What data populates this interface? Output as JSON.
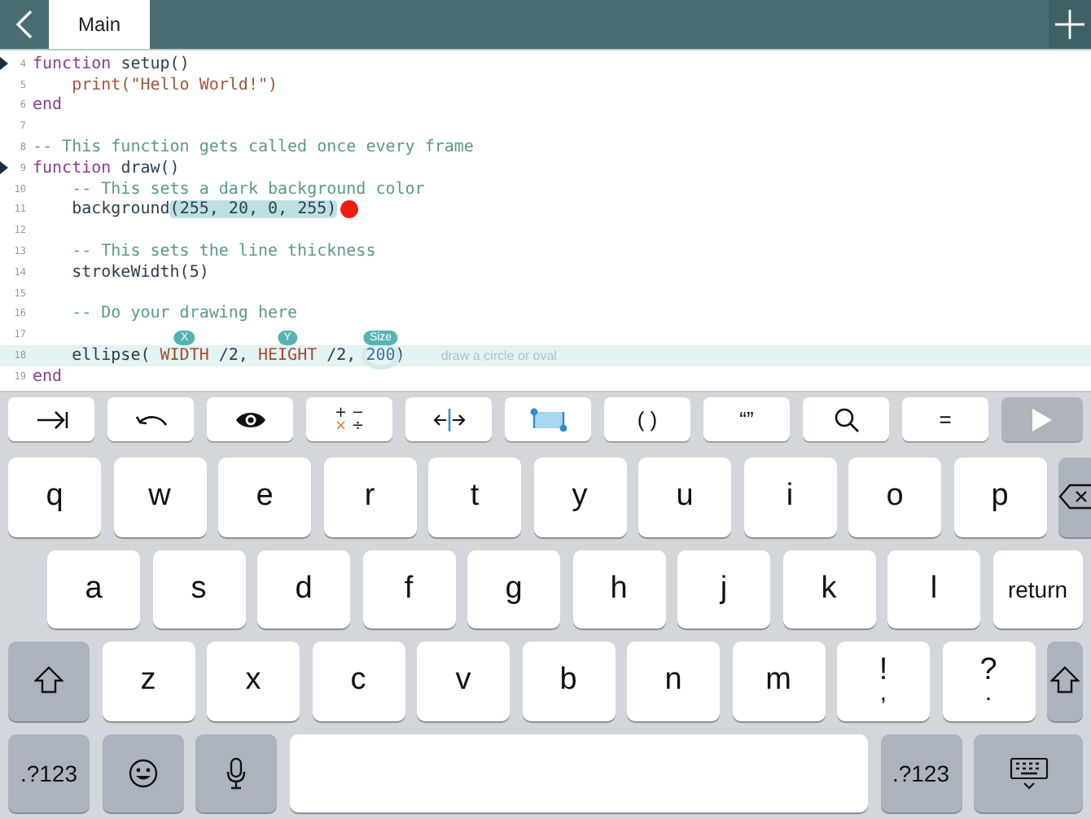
{
  "top_bar": {
    "tabs": [
      {
        "label": "Main",
        "selected": true
      }
    ]
  },
  "editor": {
    "lines": [
      {
        "number": "4",
        "fold": true,
        "current": false,
        "tokens": [
          {
            "kind": "keyword",
            "text": "function"
          },
          {
            "kind": "plain",
            "text": " setup()"
          }
        ]
      },
      {
        "number": "5",
        "fold": false,
        "current": false,
        "indented": true,
        "tokens": [
          {
            "kind": "string",
            "text": "print(\"Hello World!\")"
          }
        ]
      },
      {
        "number": "6",
        "fold": false,
        "current": false,
        "tokens": [
          {
            "kind": "keyword",
            "text": "end"
          }
        ]
      },
      {
        "number": "7",
        "fold": false,
        "current": false
      },
      {
        "number": "8",
        "fold": false,
        "current": false,
        "tokens": [
          {
            "kind": "comment",
            "text": "-- This function gets called once every frame"
          }
        ]
      },
      {
        "number": "9",
        "fold": true,
        "current": false,
        "tokens": [
          {
            "kind": "keyword",
            "text": "function"
          },
          {
            "kind": "plain",
            "text": " draw()"
          }
        ]
      },
      {
        "number": "10",
        "fold": false,
        "current": false,
        "indented": true,
        "tokens": [
          {
            "kind": "comment",
            "text": "-- This sets a dark background color"
          }
        ]
      },
      {
        "number": "11",
        "fold": false,
        "current": false,
        "indented": true,
        "color_preview": true,
        "tokens": [
          {
            "kind": "plain",
            "text": "background"
          },
          {
            "kind": "selected",
            "text": "(255, 20, 0, 255)"
          }
        ]
      },
      {
        "number": "12",
        "fold": false,
        "current": false
      },
      {
        "number": "13",
        "fold": false,
        "current": false,
        "indented": true,
        "tokens": [
          {
            "kind": "comment",
            "text": "-- This sets the line thickness"
          }
        ]
      },
      {
        "number": "14",
        "fold": false,
        "current": false,
        "indented": true,
        "tokens": [
          {
            "kind": "plain",
            "text": "strokeWidth(5)"
          }
        ]
      },
      {
        "number": "15",
        "fold": false,
        "current": false
      },
      {
        "number": "16",
        "fold": false,
        "current": false,
        "indented": true,
        "tokens": [
          {
            "kind": "comment",
            "text": "-- Do your drawing here"
          }
        ]
      },
      {
        "number": "17",
        "fold": false,
        "current": false
      },
      {
        "number": "18",
        "fold": false,
        "current": true,
        "indented": true,
        "hint": "draw a circle or oval",
        "tokens": [
          {
            "kind": "plain",
            "text": "ellipse( "
          },
          {
            "kind": "constant",
            "text": "WIDTH",
            "tag": "X"
          },
          {
            "kind": "plain",
            "text": " /2, "
          },
          {
            "kind": "constant",
            "text": "HEIGHT",
            "tag": "Y"
          },
          {
            "kind": "plain",
            "text": " /2, "
          },
          {
            "kind": "number",
            "text": "200",
            "tag": "Size"
          },
          {
            "kind": "plain",
            "text": ")"
          }
        ]
      },
      {
        "number": "19",
        "fold": false,
        "current": false,
        "tokens": [
          {
            "kind": "keyword",
            "text": "end"
          }
        ]
      }
    ]
  },
  "toolbar": [
    {
      "kind": "tab"
    },
    {
      "kind": "undo"
    },
    {
      "kind": "eye"
    },
    {
      "kind": "operators",
      "symbols": [
        "+",
        "−",
        "×",
        "÷"
      ]
    },
    {
      "kind": "cursor"
    },
    {
      "kind": "snippet"
    },
    {
      "kind": "text",
      "label": "( )"
    },
    {
      "kind": "text",
      "label": "“”"
    },
    {
      "kind": "search"
    },
    {
      "kind": "text",
      "label": "="
    },
    {
      "kind": "run"
    }
  ],
  "keyboard": {
    "rows": [
      [
        {
          "kind": "char",
          "label": "q"
        },
        {
          "kind": "char",
          "label": "w"
        },
        {
          "kind": "char",
          "label": "e"
        },
        {
          "kind": "char",
          "label": "r"
        },
        {
          "kind": "char",
          "label": "t"
        },
        {
          "kind": "char",
          "label": "y"
        },
        {
          "kind": "char",
          "label": "u"
        },
        {
          "kind": "char",
          "label": "i"
        },
        {
          "kind": "char",
          "label": "o"
        },
        {
          "kind": "char",
          "label": "p"
        },
        {
          "kind": "backspace"
        }
      ],
      [
        {
          "kind": "char",
          "label": "a"
        },
        {
          "kind": "char",
          "label": "s"
        },
        {
          "kind": "char",
          "label": "d"
        },
        {
          "kind": "char",
          "label": "f"
        },
        {
          "kind": "char",
          "label": "g"
        },
        {
          "kind": "char",
          "label": "h"
        },
        {
          "kind": "char",
          "label": "j"
        },
        {
          "kind": "char",
          "label": "k"
        },
        {
          "kind": "char",
          "label": "l"
        },
        {
          "kind": "wide",
          "label": "return"
        }
      ],
      [
        {
          "kind": "shift"
        },
        {
          "kind": "char",
          "label": "z"
        },
        {
          "kind": "char",
          "label": "x"
        },
        {
          "kind": "char",
          "label": "c"
        },
        {
          "kind": "char",
          "label": "v"
        },
        {
          "kind": "char",
          "label": "b"
        },
        {
          "kind": "char",
          "label": "n"
        },
        {
          "kind": "char",
          "label": "m"
        },
        {
          "kind": "char",
          "label": "!",
          "sub": ","
        },
        {
          "kind": "char",
          "label": "?",
          "sub": "."
        },
        {
          "kind": "shift"
        }
      ],
      [
        {
          "kind": "mode",
          "label": ".?123"
        },
        {
          "kind": "emoji"
        },
        {
          "kind": "mic"
        },
        {
          "kind": "space"
        },
        {
          "kind": "mode",
          "label": ".?123"
        },
        {
          "kind": "hide"
        }
      ]
    ]
  }
}
